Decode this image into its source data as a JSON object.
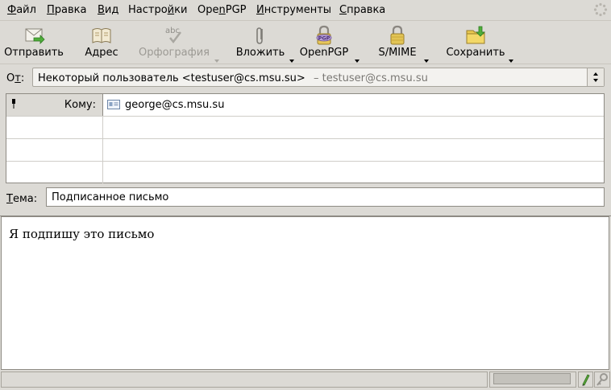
{
  "menu": {
    "items": [
      {
        "pre": "",
        "key": "Ф",
        "post": "айл"
      },
      {
        "pre": "",
        "key": "П",
        "post": "равка"
      },
      {
        "pre": "",
        "key": "В",
        "post": "ид"
      },
      {
        "pre": "Настро",
        "key": "й",
        "post": "ки"
      },
      {
        "pre": "Ope",
        "key": "n",
        "post": "PGP"
      },
      {
        "pre": "",
        "key": "И",
        "post": "нструменты"
      },
      {
        "pre": "",
        "key": "С",
        "post": "правка"
      }
    ]
  },
  "toolbar": {
    "send": "Отправить",
    "address": "Адрес",
    "spelling": "Орфография",
    "attach": "Вложить",
    "openpgp": "OpenPGP",
    "smime": "S/MIME",
    "save": "Сохранить",
    "pgp_badge": "PGP",
    "spell_badge": "abc"
  },
  "from": {
    "label_pre": "О",
    "label_key": "т",
    "label_post": ":",
    "identity": "Некоторый пользователь <testuser@cs.msu.su>",
    "account": "– testuser@cs.msu.su"
  },
  "recipients": [
    {
      "type": "Кому:",
      "address": "george@cs.msu.su"
    },
    {
      "type": "",
      "address": ""
    },
    {
      "type": "",
      "address": ""
    },
    {
      "type": "",
      "address": ""
    }
  ],
  "subject": {
    "label_key": "Т",
    "label_post": "ема:",
    "value": "Подписанное письмо"
  },
  "body": {
    "text": "Я подпишу это письмо"
  },
  "colors": {
    "chrome": "#dcdad5",
    "border": "#8e8b84"
  }
}
